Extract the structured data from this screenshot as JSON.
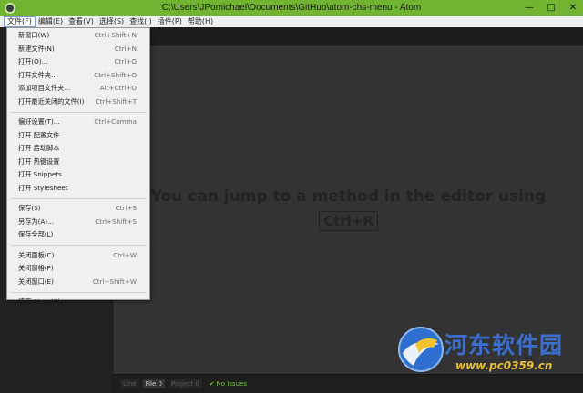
{
  "window": {
    "title": "C:\\Users\\JPomichael\\Documents\\GitHub\\atom-chs-menu - Atom",
    "controls": {
      "minimize": "—",
      "maximize": "□",
      "close": "✕"
    }
  },
  "menubar": {
    "items": [
      {
        "label": "文件(F)"
      },
      {
        "label": "编辑(E)"
      },
      {
        "label": "查看(V)"
      },
      {
        "label": "选择(S)"
      },
      {
        "label": "查找(I)"
      },
      {
        "label": "插件(P)"
      },
      {
        "label": "帮助(H)"
      }
    ]
  },
  "file_menu": {
    "items": [
      {
        "label": "新窗口(W)",
        "shortcut": "Ctrl+Shift+N"
      },
      {
        "label": "新建文件(N)",
        "shortcut": "Ctrl+N"
      },
      {
        "label": "打开(O)...",
        "shortcut": "Ctrl+O"
      },
      {
        "label": "打开文件夹...",
        "shortcut": "Ctrl+Shift+O"
      },
      {
        "label": "添加项目文件夹...",
        "shortcut": "Alt+Ctrl+O"
      },
      {
        "label": "打开最近关闭的文件(I)",
        "shortcut": "Ctrl+Shift+T"
      },
      {
        "label": "偏好设置(T)...",
        "shortcut": "Ctrl+Comma"
      },
      {
        "label": "打开 配置文件",
        "shortcut": ""
      },
      {
        "label": "打开 启动脚本",
        "shortcut": ""
      },
      {
        "label": "打开 热键设置",
        "shortcut": ""
      },
      {
        "label": "打开 Snippets",
        "shortcut": ""
      },
      {
        "label": "打开 Stylesheet",
        "shortcut": ""
      },
      {
        "label": "保存(S)",
        "shortcut": "Ctrl+S"
      },
      {
        "label": "另存为(A)...",
        "shortcut": "Ctrl+Shift+S"
      },
      {
        "label": "保存全部(L)",
        "shortcut": ""
      },
      {
        "label": "关闭面板(C)",
        "shortcut": "Ctrl+W"
      },
      {
        "label": "关闭窗格(P)",
        "shortcut": ""
      },
      {
        "label": "关闭窗口(E)",
        "shortcut": "Ctrl+Shift+W"
      },
      {
        "label": "结束 Atom(X)",
        "shortcut": ""
      }
    ]
  },
  "editor": {
    "welcome_line": "You can jump to a method in the editor using",
    "welcome_key": "Ctrl+R"
  },
  "statusbar": {
    "line": "Line",
    "file": "File",
    "file_count": "0",
    "project": "Project",
    "project_count": "0",
    "issues": "No Issues"
  },
  "watermark": {
    "title": "河东软件园",
    "url": "www.pc0359.cn"
  },
  "colors": {
    "titlebar": "#71b431",
    "editor_bg": "#333333",
    "watermark_blue": "#3a6fcf",
    "watermark_gold": "#e8c23a"
  }
}
